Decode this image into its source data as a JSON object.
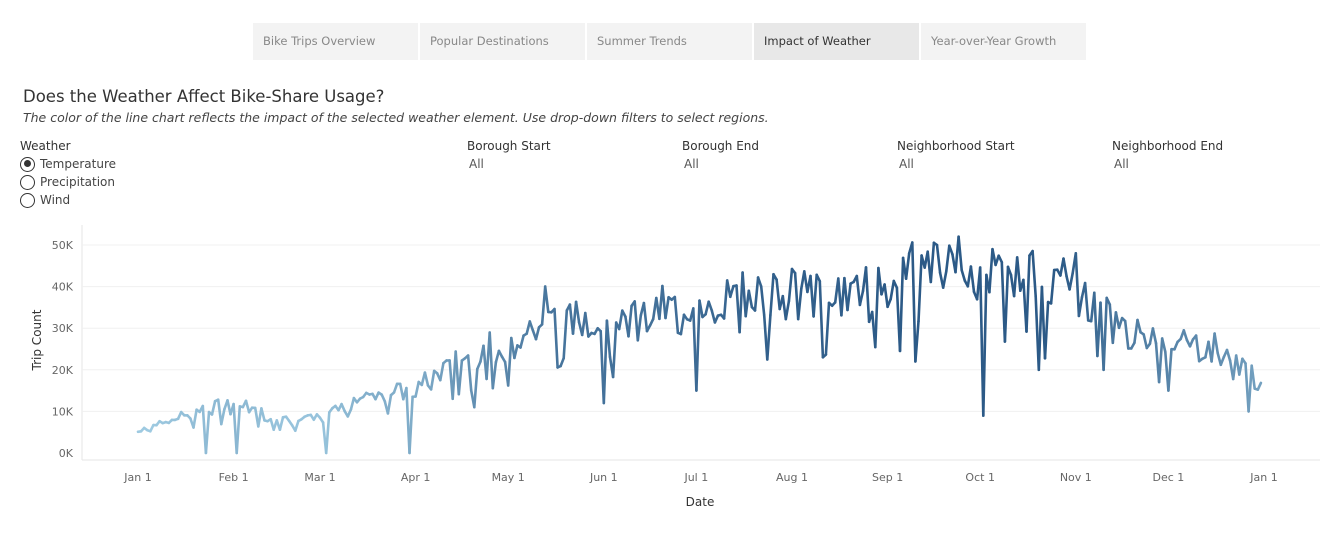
{
  "tabs": [
    "Bike Trips Overview",
    "Popular Destinations",
    "Summer Trends",
    "Impact of Weather",
    "Year-over-Year Growth"
  ],
  "active_tab": "Impact of Weather",
  "title": "Does the Weather Affect Bike-Share Usage?",
  "subtitle": "The color of the line chart reflects the impact of the selected weather element. Use drop-down filters to select regions.",
  "weather": {
    "label": "Weather",
    "options": [
      "Temperature",
      "Precipitation",
      "Wind"
    ],
    "selected": "Temperature"
  },
  "filters": [
    {
      "label": "Borough Start",
      "value": "All"
    },
    {
      "label": "Borough End",
      "value": "All"
    },
    {
      "label": "Neighborhood Start",
      "value": "All"
    },
    {
      "label": "Neighborhood End",
      "value": "All"
    }
  ],
  "chart_data": {
    "type": "line",
    "xlabel": "Date",
    "ylabel": "Trip Count",
    "x_ticks": [
      "Jan 1",
      "Feb 1",
      "Mar 1",
      "Apr 1",
      "May 1",
      "Jun 1",
      "Jul 1",
      "Aug 1",
      "Sep 1",
      "Oct 1",
      "Nov 1",
      "Dec 1",
      "Jan 1"
    ],
    "y_ticks": [
      "0K",
      "10K",
      "20K",
      "30K",
      "40K",
      "50K"
    ],
    "ylim": [
      0,
      52000
    ],
    "grid": true,
    "color_scale": {
      "low": "#9ecae1",
      "high": "#2c5a87"
    },
    "color_encodes": "Temperature",
    "monthly_anchors": [
      {
        "x": "Jan 1",
        "y": 5000
      },
      {
        "x": "Jan 15",
        "y": 9000
      },
      {
        "x": "Feb 1",
        "y": 12000
      },
      {
        "x": "Feb 15",
        "y": 8000
      },
      {
        "x": "Mar 1",
        "y": 8000
      },
      {
        "x": "Mar 15",
        "y": 14000
      },
      {
        "x": "Apr 1",
        "y": 15000
      },
      {
        "x": "Apr 15",
        "y": 22000
      },
      {
        "x": "May 1",
        "y": 27000
      },
      {
        "x": "May 15",
        "y": 32000
      },
      {
        "x": "Jun 1",
        "y": 33000
      },
      {
        "x": "Jun 15",
        "y": 33000
      },
      {
        "x": "Jul 1",
        "y": 35000
      },
      {
        "x": "Jul 15",
        "y": 37000
      },
      {
        "x": "Aug 1",
        "y": 39000
      },
      {
        "x": "Aug 15",
        "y": 38000
      },
      {
        "x": "Sep 1",
        "y": 40000
      },
      {
        "x": "Sep 15",
        "y": 45000
      },
      {
        "x": "Oct 1",
        "y": 40000
      },
      {
        "x": "Oct 15",
        "y": 43000
      },
      {
        "x": "Nov 1",
        "y": 38000
      },
      {
        "x": "Nov 15",
        "y": 30000
      },
      {
        "x": "Dec 1",
        "y": 27000
      },
      {
        "x": "Dec 15",
        "y": 25000
      },
      {
        "x": "Dec 31",
        "y": 18000
      }
    ],
    "dips": [
      {
        "x": "Jan 23",
        "y": 0
      },
      {
        "x": "Feb 2",
        "y": 0
      },
      {
        "x": "Mar 3",
        "y": 0
      },
      {
        "x": "Mar 30",
        "y": 0
      },
      {
        "x": "Apr 20",
        "y": 11000
      },
      {
        "x": "Jun 1",
        "y": 12000
      },
      {
        "x": "Jul 1",
        "y": 15000
      },
      {
        "x": "Aug 11",
        "y": 23000
      },
      {
        "x": "Sep 10",
        "y": 22000
      },
      {
        "x": "Oct 2",
        "y": 9000
      },
      {
        "x": "Oct 20",
        "y": 20000
      },
      {
        "x": "Nov 10",
        "y": 20000
      },
      {
        "x": "Dec 1",
        "y": 15000
      },
      {
        "x": "Dec 27",
        "y": 10000
      }
    ],
    "peaks": [
      {
        "x": "May 13",
        "y": 40000
      },
      {
        "x": "Sep 17",
        "y": 50000
      },
      {
        "x": "Sep 24",
        "y": 52000
      },
      {
        "x": "Oct 5",
        "y": 49000
      },
      {
        "x": "Nov 1",
        "y": 48000
      }
    ]
  }
}
